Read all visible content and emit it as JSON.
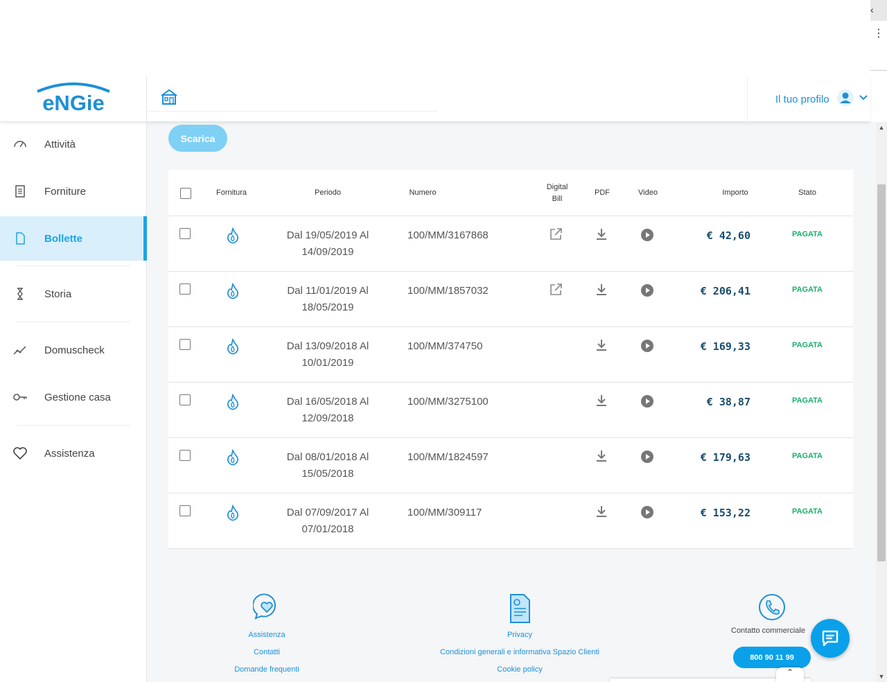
{
  "brand": {
    "logo_text": "eNGie",
    "color": "#1e8fd6"
  },
  "header": {
    "profile_label": "Il tuo profilo"
  },
  "sidebar": {
    "items": [
      {
        "label": "Attività",
        "icon": "gauge-icon"
      },
      {
        "label": "Forniture",
        "icon": "document-list-icon"
      },
      {
        "label": "Bollette",
        "icon": "file-icon",
        "active": true
      },
      {
        "label": "Storia",
        "icon": "hourglass-icon"
      },
      {
        "label": "Domuscheck",
        "icon": "trend-icon"
      },
      {
        "label": "Gestione casa",
        "icon": "key-icon"
      },
      {
        "label": "Assistenza",
        "icon": "heart-icon"
      }
    ],
    "active_color": "#1ea5e4"
  },
  "main": {
    "download_label": "Scarica",
    "table": {
      "headers": {
        "fornitura": "Fornitura",
        "periodo": "Periodo",
        "numero": "Numero",
        "digital_bill_1": "Digital",
        "digital_bill_2": "Bill",
        "pdf": "PDF",
        "video": "Video",
        "importo": "Importo",
        "stato": "Stato"
      },
      "rows": [
        {
          "period_1": "Dal 19/05/2019 Al",
          "period_2": "14/09/2019",
          "number": "100/MM/3167868",
          "digital_bill": true,
          "amount": "€ 42,60",
          "status": "PAGATA"
        },
        {
          "period_1": "Dal 11/01/2019 Al",
          "period_2": "18/05/2019",
          "number": "100/MM/1857032",
          "digital_bill": true,
          "amount": "€ 206,41",
          "status": "PAGATA"
        },
        {
          "period_1": "Dal 13/09/2018 Al",
          "period_2": "10/01/2019",
          "number": "100/MM/374750",
          "digital_bill": false,
          "amount": "€ 169,33",
          "status": "PAGATA"
        },
        {
          "period_1": "Dal 16/05/2018 Al",
          "period_2": "12/09/2018",
          "number": "100/MM/3275100",
          "digital_bill": false,
          "amount": "€ 38,87",
          "status": "PAGATA"
        },
        {
          "period_1": "Dal 08/01/2018 Al",
          "period_2": "15/05/2018",
          "number": "100/MM/1824597",
          "digital_bill": false,
          "amount": "€ 179,63",
          "status": "PAGATA"
        },
        {
          "period_1": "Dal 07/09/2017 Al",
          "period_2": "07/01/2018",
          "number": "100/MM/309117",
          "digital_bill": false,
          "amount": "€ 153,22",
          "status": "PAGATA"
        }
      ],
      "status_color": "#18b06b"
    }
  },
  "footer": {
    "assistance": {
      "links": [
        "Assistenza",
        "Contatti",
        "Domande frequenti"
      ]
    },
    "legal": {
      "links": [
        "Privacy",
        "Condizioni generali e informativa Spazio Clienti",
        "Cookie policy"
      ]
    },
    "contact": {
      "label": "Contatto commerciale",
      "phone": "800 90 11 99"
    }
  }
}
